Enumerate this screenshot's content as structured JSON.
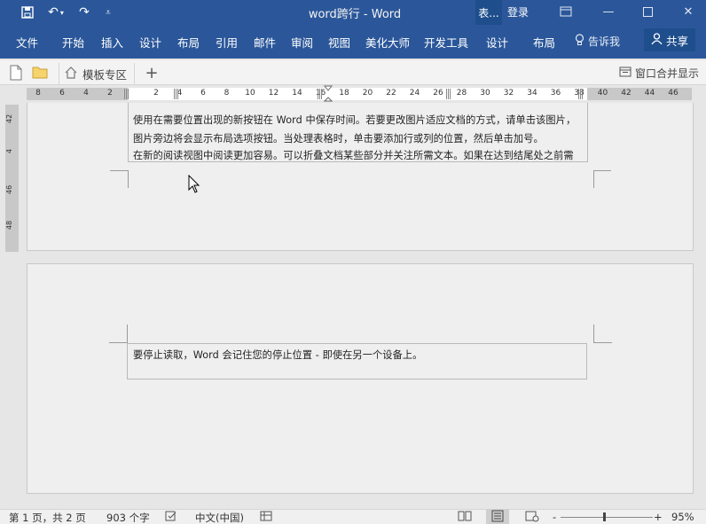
{
  "titlebar": {
    "doc_title": "word跨行 - Word",
    "context_label": "表...",
    "login": "登录"
  },
  "ribbon": {
    "tabs": [
      "文件",
      "开始",
      "插入",
      "设计",
      "布局",
      "引用",
      "邮件",
      "审阅",
      "视图",
      "美化大师",
      "开发工具"
    ],
    "context_tabs": [
      "设计",
      "布局"
    ],
    "tell_me": "告诉我",
    "share": "共享"
  },
  "docbar": {
    "template_tab": "模板专区",
    "merge_window": "窗口合并显示"
  },
  "ruler": {
    "numbers_left": [
      "8",
      "6",
      "4",
      "2"
    ],
    "numbers_right": [
      "2",
      "4",
      "6",
      "8",
      "10",
      "12",
      "14",
      "16",
      "18",
      "20",
      "22",
      "24",
      "26",
      "28",
      "30",
      "32",
      "34",
      "36",
      "38",
      "40",
      "42",
      "44",
      "46"
    ],
    "vertical": [
      "42",
      "4",
      "46",
      "48"
    ]
  },
  "page1": {
    "lines": [
      "使用在需要位置出现的新按钮在 Word 中保存时间。若要更改图片适应文档的方式，请单击该图片，",
      "图片旁边将会显示布局选项按钮。当处理表格时，单击要添加行或列的位置，然后单击加号。",
      "在新的阅读视图中阅读更加容易。可以折叠文档某些部分并关注所需文本。如果在达到结尾处之前需"
    ]
  },
  "page2": {
    "lines": [
      "要停止读取，Word 会记住您的停止位置 - 即使在另一个设备上。"
    ]
  },
  "status": {
    "page": "第 1 页，共 2 页",
    "words": "903 个字",
    "language": "中文(中国)",
    "zoom": "95%"
  },
  "colors": {
    "accent": "#2b579a",
    "context_accent": "#1e4e8c"
  }
}
